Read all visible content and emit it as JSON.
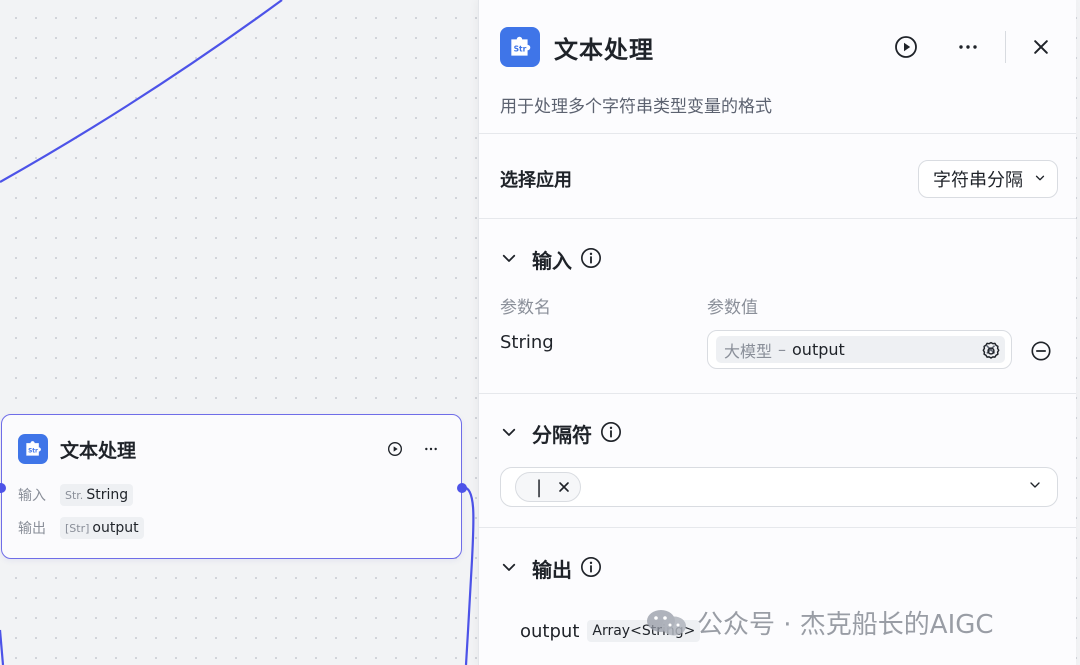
{
  "canvas_node": {
    "title": "文本处理",
    "input_label": "输入",
    "input_type_prefix": "Str.",
    "input_value": "String",
    "output_label": "输出",
    "output_type_prefix": "[Str]",
    "output_value": "output"
  },
  "panel": {
    "title": "文本处理",
    "description": "用于处理多个字符串类型变量的格式",
    "select_app_label": "选择应用",
    "select_app_value": "字符串分隔",
    "input_section": {
      "title": "输入",
      "col_name": "参数名",
      "col_value": "参数值",
      "param_name": "String",
      "ref_source": "大模型",
      "ref_sep": "–",
      "ref_field": "output"
    },
    "delimiter_section": {
      "title": "分隔符",
      "chip_value": "|"
    },
    "output_section": {
      "title": "输出",
      "output_name": "output",
      "output_type": "Array<String>"
    }
  },
  "watermark": "公众号 · 杰克船长的AIGC",
  "colors": {
    "accent": "#4d53e8",
    "icon_bg": "#3f75e8",
    "node_border": "#6f6de8"
  },
  "icons": [
    "puzzle-str-icon",
    "play-icon",
    "more-icon",
    "close-icon",
    "chevron-down-icon",
    "info-icon",
    "gear-icon",
    "minus-circle-icon",
    "remove-icon",
    "wechat-icon"
  ]
}
